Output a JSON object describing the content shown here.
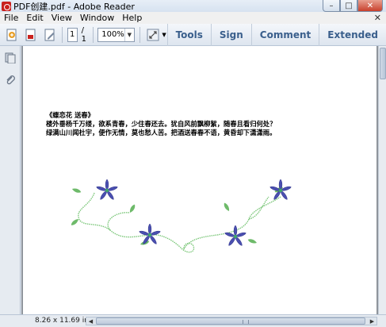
{
  "window": {
    "title": "PDF创建.pdf - Adobe Reader",
    "minimize": "–",
    "maximize": "□",
    "close": "✕"
  },
  "menu": {
    "items": [
      "File",
      "Edit",
      "View",
      "Window",
      "Help"
    ],
    "doc_close": "✕"
  },
  "toolbar": {
    "page_current": "1",
    "page_total": "/ 1",
    "zoom": "100%",
    "buttons": [
      "Tools",
      "Sign",
      "Comment",
      "Extended"
    ]
  },
  "document": {
    "poem_lines": [
      "《蝶恋花 送春》",
      "楼外垂杨千万缕，欲系青春，少住春还去。犹自风前飘柳絮，随春且看归何处？",
      "绿满山川闻杜宇，便作无情，莫也愁人苦。把酒送春春不语，黄昏却下潇潇雨。"
    ]
  },
  "status": {
    "page_size": "8.26 x 11.69 in"
  },
  "colors": {
    "flower_petal": "#4a4fb0",
    "flower_center": "#3ea86a",
    "vine": "#7cc77a",
    "leaf": "#5fb35a"
  }
}
